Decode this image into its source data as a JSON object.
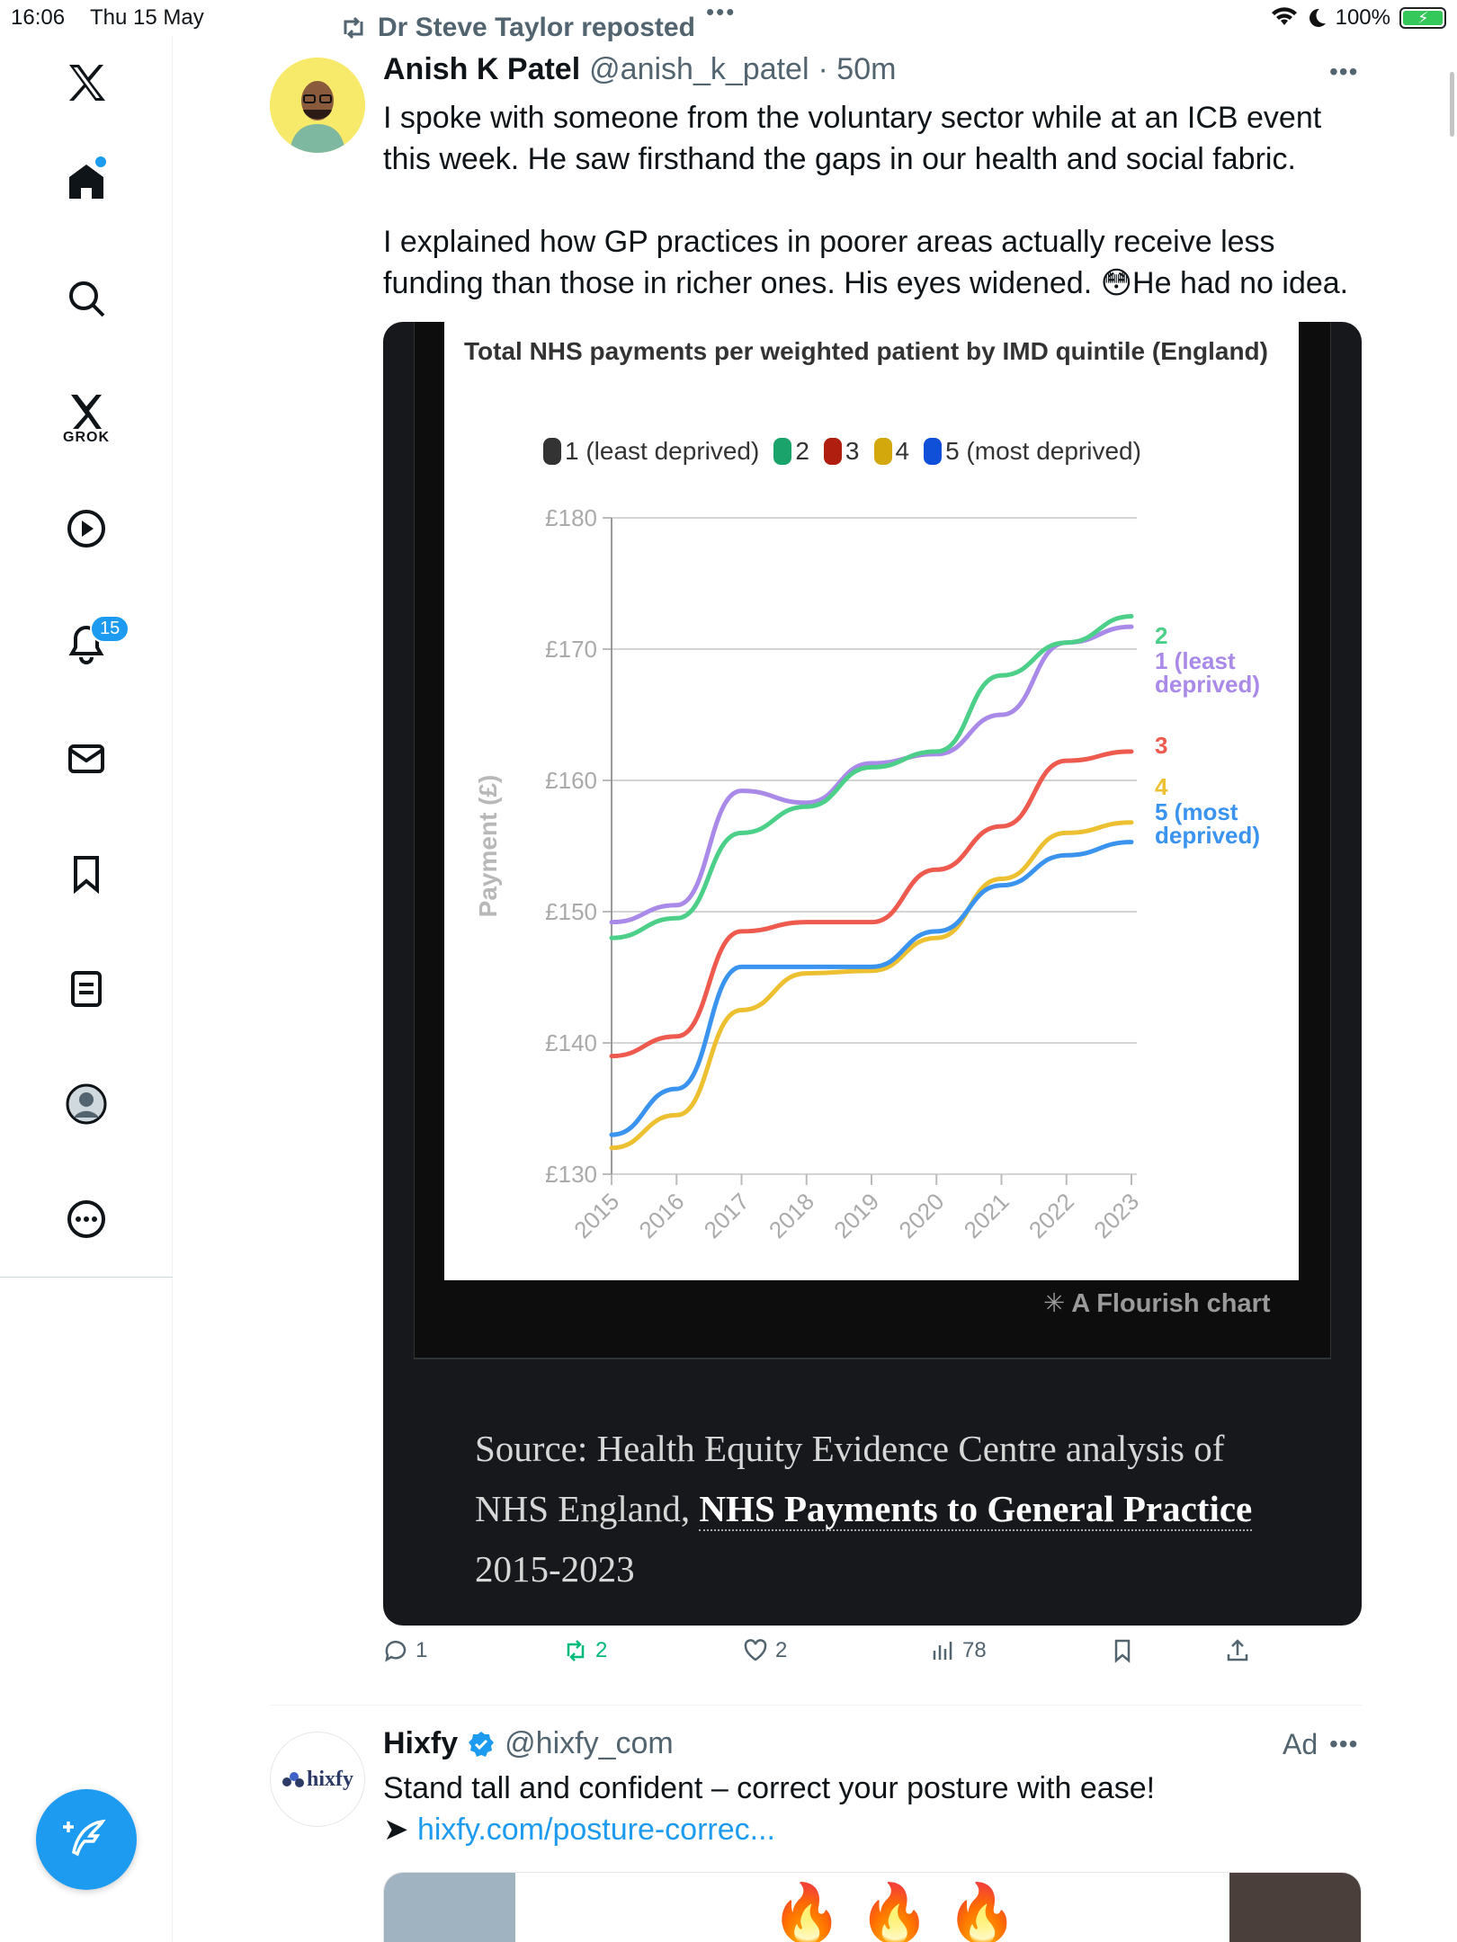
{
  "status_bar": {
    "time": "16:06",
    "date": "Thu 15 May",
    "battery": "100%"
  },
  "sidebar": {
    "notifications_badge": "15",
    "grok_label": "GROK"
  },
  "tweet": {
    "repost_by": "Dr Steve Taylor reposted",
    "author_name": "Anish K Patel",
    "author_handle": "@anish_k_patel",
    "time_ago": "· 50m",
    "paragraph1": "I spoke with someone from the voluntary sector while at an ICB event this week. He saw firsthand the gaps in our health and social fabric.",
    "paragraph2_start": "I explained how GP practices in poorer areas actually receive less funding than those in richer ones. His eyes widened. ",
    "paragraph2_emoji": "😳",
    "paragraph2_end": "He had no idea.",
    "reply_count": "1",
    "repost_count": "2",
    "like_count": "2",
    "view_count": "78"
  },
  "chart_data": {
    "type": "line",
    "title": "Total NHS payments per weighted patient by IMD quintile (England)",
    "ylabel": "Payment (£)",
    "ylim": [
      130,
      180
    ],
    "yticks": [
      "£130",
      "£140",
      "£150",
      "£160",
      "£170",
      "£180"
    ],
    "x": [
      "2015",
      "2016",
      "2017",
      "2018",
      "2019",
      "2020",
      "2021",
      "2022",
      "2023"
    ],
    "legend": [
      "1 (least deprived)",
      "2",
      "3",
      "4",
      "5 (most deprived)"
    ],
    "legend_colors": [
      "#333333",
      "#1aa36a",
      "#b01e10",
      "#d2a80c",
      "#1050d8"
    ],
    "series": [
      {
        "name": "1 (least deprived)",
        "end_label": "1 (least deprived)",
        "color": "#a98ae8",
        "values": [
          149.2,
          150.5,
          159.2,
          158.3,
          161.3,
          162.0,
          165.0,
          170.5,
          171.7
        ]
      },
      {
        "name": "2",
        "end_label": "2",
        "color": "#4ccf88",
        "values": [
          148.0,
          149.5,
          156.0,
          158.0,
          161.0,
          162.2,
          168.0,
          170.5,
          172.5
        ]
      },
      {
        "name": "3",
        "end_label": "3",
        "color": "#ee5a4e",
        "values": [
          139.0,
          140.5,
          148.5,
          149.2,
          149.2,
          153.2,
          156.5,
          161.5,
          162.2
        ]
      },
      {
        "name": "4",
        "end_label": "4",
        "color": "#edc032",
        "values": [
          132.0,
          134.5,
          142.5,
          145.3,
          145.5,
          148.0,
          152.5,
          156.0,
          156.8
        ]
      },
      {
        "name": "5 (most deprived)",
        "end_label": "5 (most deprived)",
        "color": "#3a93ee",
        "values": [
          133.0,
          136.5,
          145.8,
          145.8,
          145.8,
          148.5,
          152.0,
          154.3,
          155.3
        ]
      }
    ],
    "grid": true,
    "watermark": "A Flourish chart"
  },
  "source": {
    "prefix": "Source: Health Equity Evidence Centre analysis of NHS England, ",
    "link": "NHS Payments to General Practice",
    "suffix": " 2015-2023"
  },
  "ad": {
    "name": "Hixfy",
    "handle": "@hixfy_com",
    "label": "Ad",
    "text": "Stand tall and confident – correct your posture with ease!",
    "arrow": "➤ ",
    "link": "hixfy.com/posture-correc...",
    "avatar_text": "hixfy",
    "image_emojis": "🔥🔥🔥"
  },
  "colors": {
    "accent": "#1d9bf0",
    "repost_green": "#00ba7c"
  }
}
